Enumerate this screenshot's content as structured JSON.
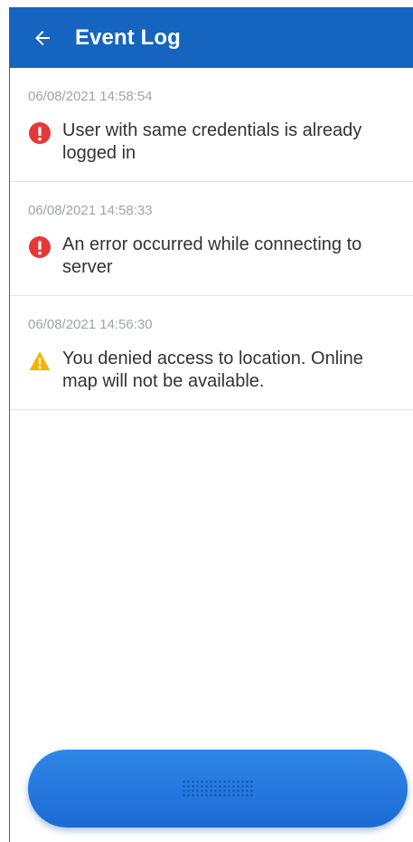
{
  "header": {
    "title": "Event Log",
    "back_icon": "arrow-left-icon"
  },
  "events": [
    {
      "timestamp": "06/08/2021 14:58:54",
      "message": "User with same credentials is already logged in",
      "level": "error",
      "icon": "error-circle-icon"
    },
    {
      "timestamp": "06/08/2021 14:58:33",
      "message": "An error occurred while connecting to server",
      "level": "error",
      "icon": "error-circle-icon"
    },
    {
      "timestamp": "06/08/2021 14:56:30",
      "message": "You denied access to location. Online map will not be available.",
      "level": "warning",
      "icon": "warning-triangle-icon"
    }
  ],
  "colors": {
    "app_bar": "#1565c0",
    "error": "#e53935",
    "warning": "#f4b400",
    "timestamp": "#a0a4a8",
    "text": "#333333",
    "button": "#2f86e6"
  },
  "bottom_control": {
    "icon": "grip-dots-icon"
  }
}
